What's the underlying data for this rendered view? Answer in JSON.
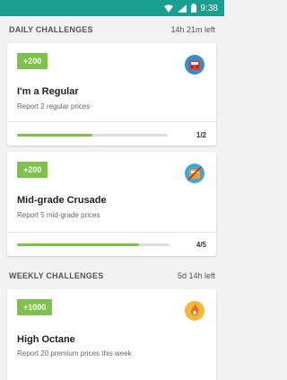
{
  "status_bar": {
    "time": "9:38"
  },
  "daily": {
    "title": "DAILY CHALLENGES",
    "time_left": "14h 21m left",
    "cards": [
      {
        "points": "+200",
        "title": "I'm a Regular",
        "desc": "Report 2 regular prices",
        "progress": "1/2",
        "fraction": 0.5,
        "icon": "regular-pump-icon"
      },
      {
        "points": "+200",
        "title": "Mid-grade Crusade",
        "desc": "Report 5 mid-grade prices",
        "progress": "4/5",
        "fraction": 0.8,
        "icon": "midgrade-pump-icon"
      }
    ]
  },
  "weekly": {
    "title": "WEEKLY CHALLENGES",
    "time_left": "5d 14h left",
    "cards": [
      {
        "points": "+1000",
        "title": "High Octane",
        "desc": "Report 20 premium prices this week",
        "icon": "premium-flame-icon"
      }
    ]
  },
  "colors": {
    "statusbar": "#1a9e8f",
    "accent": "#7dc34a"
  }
}
